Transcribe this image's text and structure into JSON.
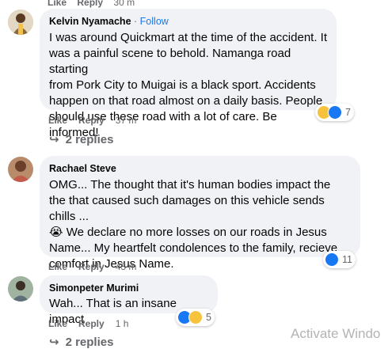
{
  "top_cut": {
    "like": "Like",
    "reply": "Reply",
    "time": "30 m"
  },
  "comments": [
    {
      "author": "Kelvin Nyamache",
      "separator": "·",
      "follow": "Follow",
      "text_lines": [
        "I was around Quickmart at the time of the accident. It",
        "was a painful scene to behold. Namanga road starting",
        "from Pork City to Muigai is a black sport. Accidents",
        "happen on that road almost on a daily basis. People",
        "should use these road with a lot of care. Be informed!"
      ],
      "reaction_count": "7",
      "like": "Like",
      "reply": "Reply",
      "time": "37 m",
      "replies": "2 replies"
    },
    {
      "author": "Rachael Steve",
      "text_lines": [
        "OMG... The thought that it's human bodies impact the",
        "the that caused such damages on this vehicle sends chills ...",
        "😭 We declare no more losses on our roads in Jesus",
        "Name... My heartfelt condolences to the family, recieve",
        "comfort in Jesus Name."
      ],
      "reaction_count": "11",
      "like": "Like",
      "reply": "Reply",
      "time": "43 m"
    },
    {
      "author": "Simonpeter Murimi",
      "text_lines": [
        "Wah... That is an insane impact"
      ],
      "reaction_count": "5",
      "like": "Like",
      "reply": "Reply",
      "time": "1 h",
      "replies_partial": "2 replies"
    }
  ],
  "watermark": "Activate Windo",
  "colors": {
    "bubble": "#f0f2f5",
    "link": "#1877f2",
    "meta": "#65676b"
  }
}
